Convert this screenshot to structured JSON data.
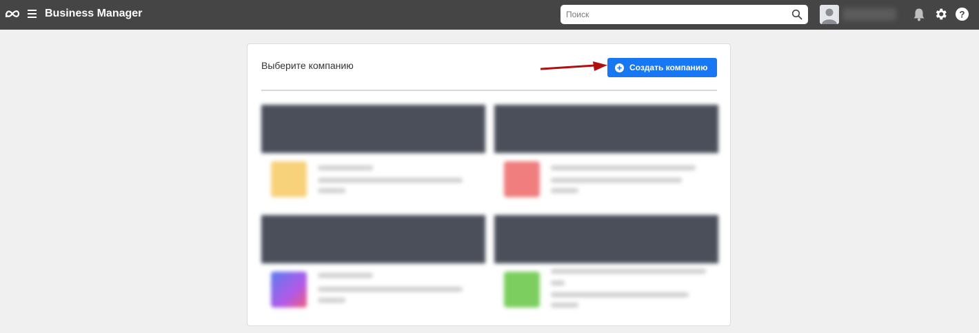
{
  "header": {
    "app_title": "Business Manager",
    "search_placeholder": "Поиск",
    "icons": [
      "meta-logo",
      "menu-icon",
      "search-icon",
      "avatar",
      "bell-icon",
      "gear-icon",
      "help-icon"
    ]
  },
  "main": {
    "title": "Выберите компанию",
    "create_button_label": "Создать компанию",
    "accent_color": "#1877f2",
    "arrow_color": "#b01010",
    "companies_blurred": true,
    "company_logo_colors": [
      "#f8d27a",
      "#f07e7e",
      "#7a6ff0",
      "#7ccf5f"
    ]
  }
}
